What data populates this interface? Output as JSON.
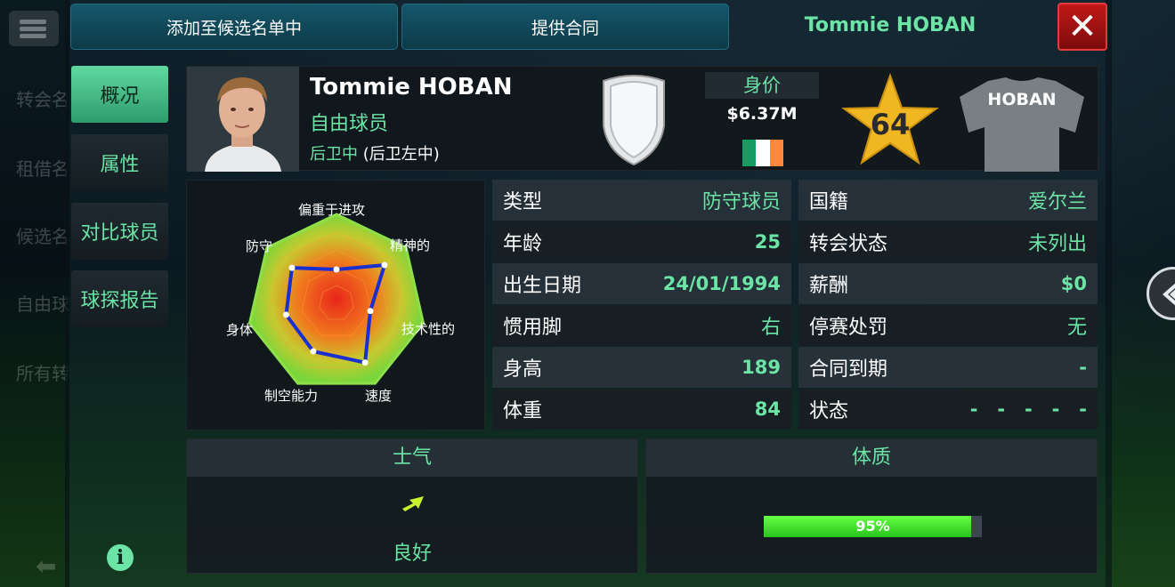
{
  "background_menu": {
    "items": [
      "转会名",
      "租借名",
      "候选名",
      "自由球",
      "所有转"
    ]
  },
  "top_bar": {
    "add_shortlist": "添加至候选名单中",
    "offer_contract": "提供合同",
    "player_title": "Tommie HOBAN",
    "close_label": "✕"
  },
  "tabs": [
    "概况",
    "属性",
    "对比球员",
    "球探报告"
  ],
  "info_icon": "i",
  "player": {
    "name": "Tommie HOBAN",
    "status": "自由球员",
    "position_main": "后卫中",
    "position_alt": " (后卫左中)",
    "value_label": "身价",
    "value": "$6.37M",
    "rating": "64",
    "shirt_name": "HOBAN",
    "flag_colors": [
      "#169b62",
      "#ffffff",
      "#ff883e"
    ]
  },
  "radar": {
    "labels": [
      "偏重于进攻",
      "精神的",
      "技术性的",
      "速度",
      "制空能力",
      "身体",
      "防守"
    ],
    "values": [
      0.38,
      0.69,
      0.39,
      0.74,
      0.6,
      0.58,
      0.64
    ]
  },
  "stats_left": [
    {
      "k": "类型",
      "v": "防守球员"
    },
    {
      "k": "年龄",
      "v": "25"
    },
    {
      "k": "出生日期",
      "v": "24/01/1994"
    },
    {
      "k": "惯用脚",
      "v": "右"
    },
    {
      "k": "身高",
      "v": "189"
    },
    {
      "k": "体重",
      "v": "84"
    }
  ],
  "stats_right": [
    {
      "k": "国籍",
      "v": "爱尔兰"
    },
    {
      "k": "转会状态",
      "v": "未列出"
    },
    {
      "k": "薪酬",
      "v": "$0"
    },
    {
      "k": "停赛处罚",
      "v": "无"
    },
    {
      "k": "合同到期",
      "v": "-"
    },
    {
      "k": "状态",
      "v": "-   -   -   -   -"
    }
  ],
  "morale": {
    "title": "士气",
    "value": "良好"
  },
  "fitness": {
    "title": "体质",
    "value": 0.95,
    "label": "95%"
  },
  "colors": {
    "accent": "#6be4a6",
    "close": "#c01818"
  }
}
